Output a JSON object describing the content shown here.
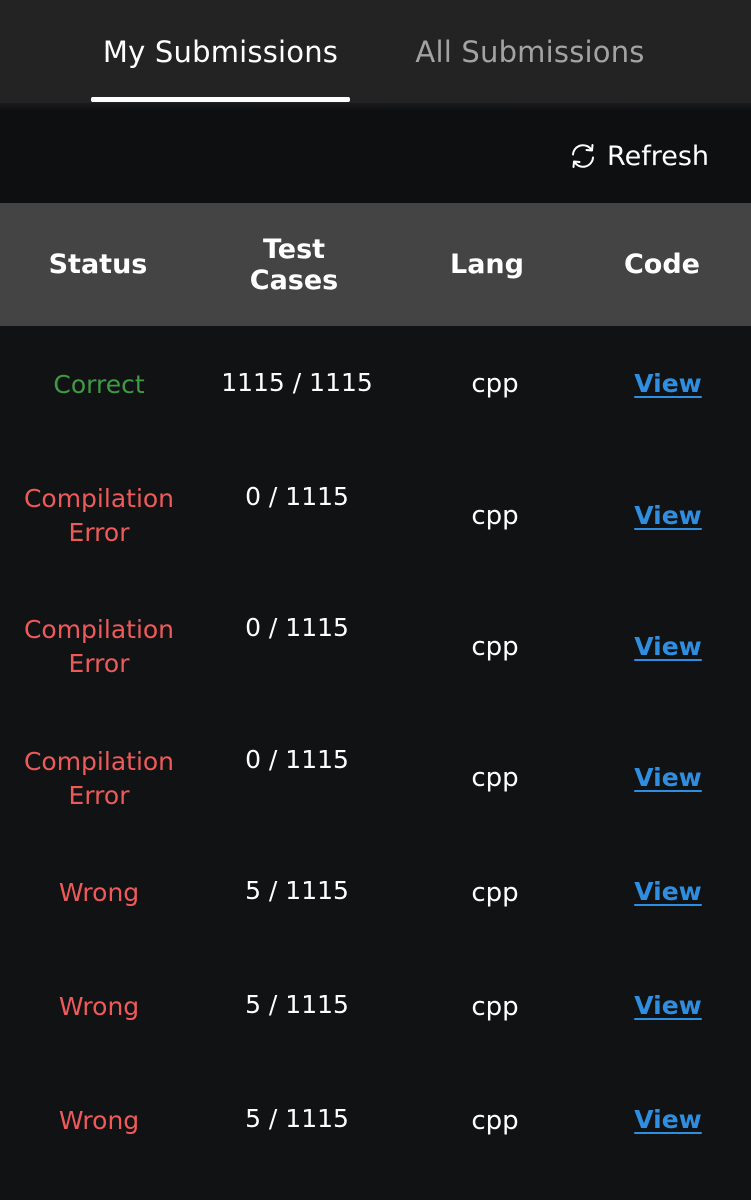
{
  "tabs": [
    {
      "label": "My Submissions",
      "active": true
    },
    {
      "label": "All Submissions",
      "active": false
    }
  ],
  "toolbar": {
    "refresh_label": "Refresh",
    "refresh_icon": "refresh-icon"
  },
  "table": {
    "headers": {
      "status": "Status",
      "test_cases_line1": "Test",
      "test_cases_line2": "Cases",
      "lang": "Lang",
      "code": "Code"
    },
    "rows": [
      {
        "status_line1": "Correct",
        "status_line2": "",
        "status_type": "correct",
        "test_cases": "1115 / 1115",
        "lang": "cpp",
        "code": "View"
      },
      {
        "status_line1": "Compilation",
        "status_line2": "Error",
        "status_type": "error",
        "test_cases": "0 / 1115",
        "lang": "cpp",
        "code": "View"
      },
      {
        "status_line1": "Compilation",
        "status_line2": "Error",
        "status_type": "error",
        "test_cases": "0 / 1115",
        "lang": "cpp",
        "code": "View"
      },
      {
        "status_line1": "Compilation",
        "status_line2": "Error",
        "status_type": "error",
        "test_cases": "0 / 1115",
        "lang": "cpp",
        "code": "View"
      },
      {
        "status_line1": "Wrong",
        "status_line2": "",
        "status_type": "error",
        "test_cases": "5 / 1115",
        "lang": "cpp",
        "code": "View"
      },
      {
        "status_line1": "Wrong",
        "status_line2": "",
        "status_type": "error",
        "test_cases": "5 / 1115",
        "lang": "cpp",
        "code": "View"
      },
      {
        "status_line1": "Wrong",
        "status_line2": "",
        "status_type": "error",
        "test_cases": "5 / 1115",
        "lang": "cpp",
        "code": "View"
      }
    ]
  },
  "colors": {
    "correct": "#3f9a45",
    "error": "#ee5a5a",
    "link": "#2f8ee0",
    "header_bg": "#444444",
    "page_bg": "#111214"
  }
}
